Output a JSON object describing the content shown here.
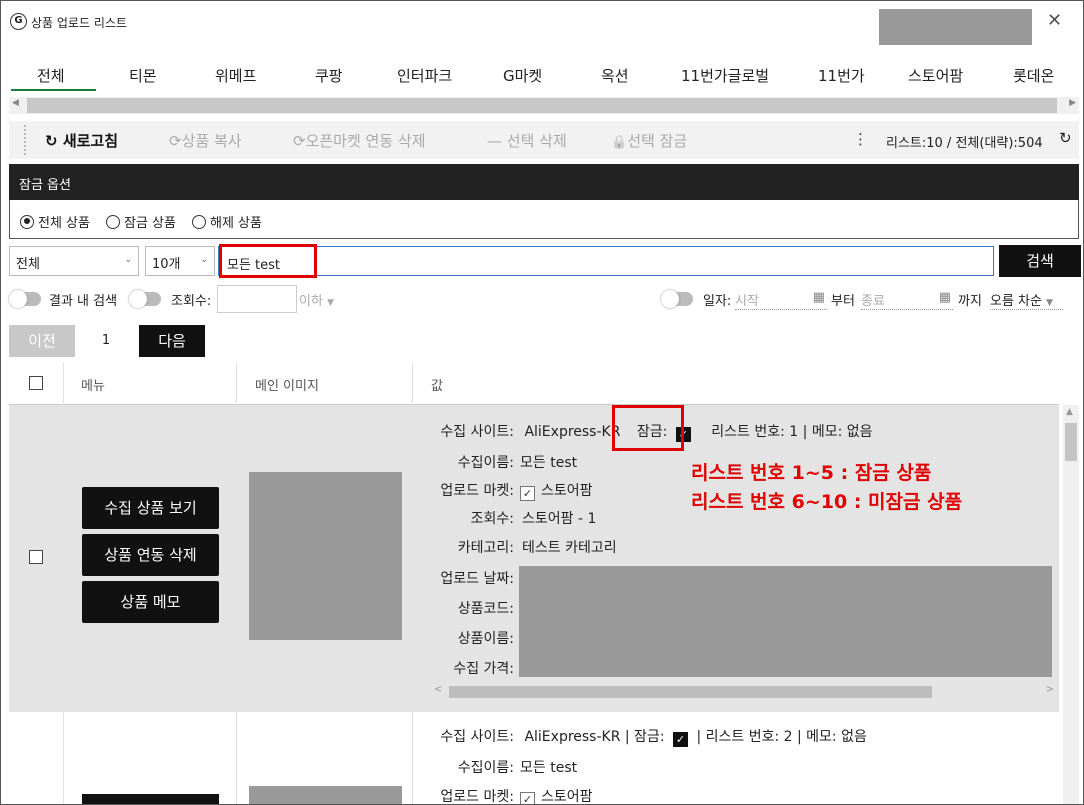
{
  "window": {
    "title": "상품 업로드 리스트",
    "logo_glyph": "G",
    "close_glyph": "✕"
  },
  "tabs": [
    "전체",
    "티몬",
    "위메프",
    "쿠팡",
    "인터파크",
    "G마켓",
    "옥션",
    "11번가글로벌",
    "11번가",
    "스토어팜",
    "롯데온"
  ],
  "active_tab": "전체",
  "toolbar": {
    "refresh": "새로고침",
    "copy": "상품 복사",
    "market_delete": "오픈마켓 연동 삭제",
    "selected_delete": "선택 삭제",
    "selected_lock": "선택 잠금",
    "count_text": "리스트:10 / 전체(대략):504"
  },
  "lock_options": {
    "title": "잠금 옵션",
    "radios": [
      "전체 상품",
      "잠금 상품",
      "해제 상품"
    ],
    "selected": "전체 상품"
  },
  "filters": {
    "scope_value": "전체",
    "count_value": "10개",
    "search_value": "모든 test",
    "search_button": "검색",
    "in_result_label": "결과 내 검색",
    "views_label": "조회수:",
    "below_label": "이하",
    "date_label": "일자:",
    "start_placeholder": "시작",
    "from_label": "부터",
    "end_placeholder": "종료",
    "until_label": "까지",
    "sort_value": "오름 차순"
  },
  "pagination": {
    "prev": "이전",
    "current": "1",
    "next": "다음"
  },
  "grid_headers": {
    "menu": "메뉴",
    "image": "메인 이미지",
    "value": "값"
  },
  "row1": {
    "buttons": [
      "수집 상품 보기",
      "상품 연동 삭제",
      "상품 메모"
    ],
    "site_label": "수집 사이트:",
    "site_value": "AliExpress-KR",
    "lock_label": "잠금:",
    "list_no_text": "리스트 번호: 1 | 메모: 없음",
    "name_label": "수집이름:",
    "name_value": "모든 test",
    "market_label": "업로드 마켓:",
    "market_value": "스토어팜",
    "views_label": "조회수:",
    "views_value": "스토어팜 - 1",
    "category_label": "카테고리:",
    "category_value": "테스트 카테고리",
    "date_label": "업로드 날짜:",
    "code_label": "상품코드:",
    "pname_label": "상품이름:",
    "price_label": "수집 가격:"
  },
  "annotation": {
    "line1": "리스트 번호 1~5 : 잠금 상품",
    "line2": "리스트 번호 6~10 : 미잠금 상품",
    "color": "#e00000"
  },
  "row2": {
    "site_label": "수집 사이트:",
    "site_value": "AliExpress-KR | 잠금:",
    "list_no_text": "| 리스트 번호: 2 | 메모: 없음",
    "name_label": "수집이름:",
    "name_value": "모든 test",
    "market_label": "업로드 마켓:",
    "market_value": "스토어팜"
  },
  "icons": {
    "refresh": "↻",
    "copy": "⟳",
    "dash": "—",
    "lock": "🔒",
    "more": "⋮",
    "calendar": "▦",
    "check": "✓",
    "chevron": "⌄"
  }
}
